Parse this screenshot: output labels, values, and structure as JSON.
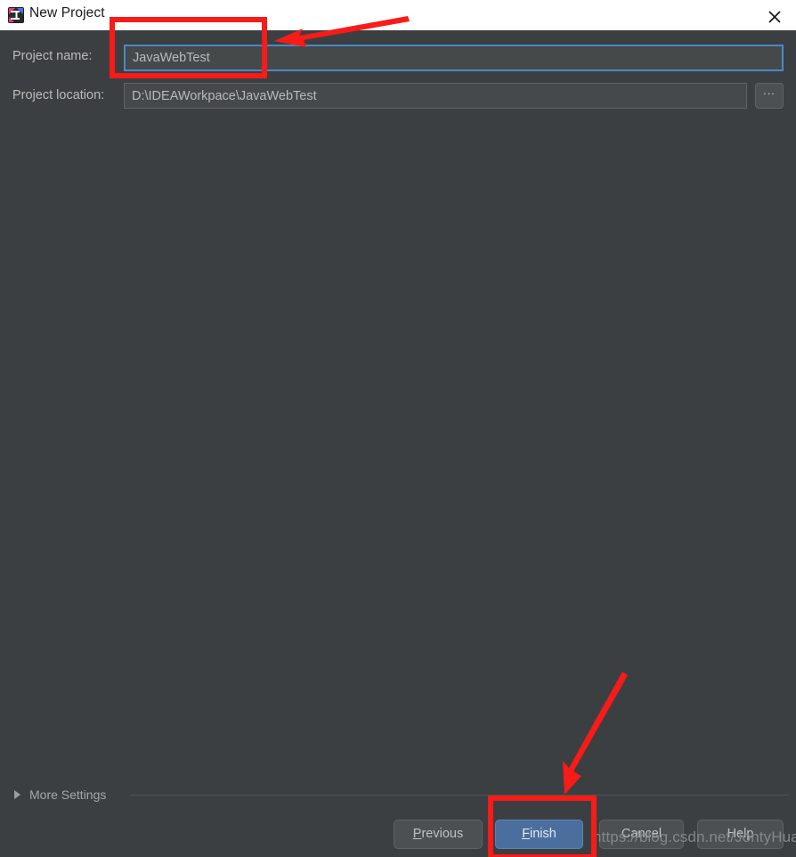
{
  "window": {
    "title": "New Project",
    "app_icon": "intellij-idea-icon",
    "close_icon": "close-icon",
    "background_color": "#3c3f41",
    "titlebar_color": "#ffffff"
  },
  "form": {
    "project_name": {
      "label": "Project name:",
      "value": "JavaWebTest",
      "placeholder": "",
      "focused": true,
      "focus_border_color": "#4a88c7"
    },
    "project_location": {
      "label": "Project location:",
      "value": "D:\\IDEAWorkpace\\JavaWebTest",
      "placeholder": "",
      "browse_label": "...",
      "browse_icon": "ellipsis-icon"
    }
  },
  "more_settings": {
    "label": "More Settings",
    "expander_icon": "chevron-right-icon",
    "expanded": false
  },
  "buttons": {
    "previous": {
      "label": "Previous",
      "mnemonic": "P",
      "primary": false
    },
    "finish": {
      "label": "Finish",
      "mnemonic": "F",
      "primary": true,
      "color": "#4a6f9e"
    },
    "cancel": {
      "label": "Cancel",
      "mnemonic": "",
      "primary": false
    },
    "help": {
      "label": "Help",
      "mnemonic": "",
      "primary": false
    }
  },
  "watermark": {
    "text": "https://blog.csdn.net/JontyHua"
  },
  "annotations": {
    "color": "#f81b18",
    "rect_project_name": "highlight-project-name-field",
    "rect_finish": "highlight-finish-button",
    "arrow_top": "arrow-pointing-to-project-name",
    "arrow_bottom": "arrow-pointing-to-finish"
  }
}
